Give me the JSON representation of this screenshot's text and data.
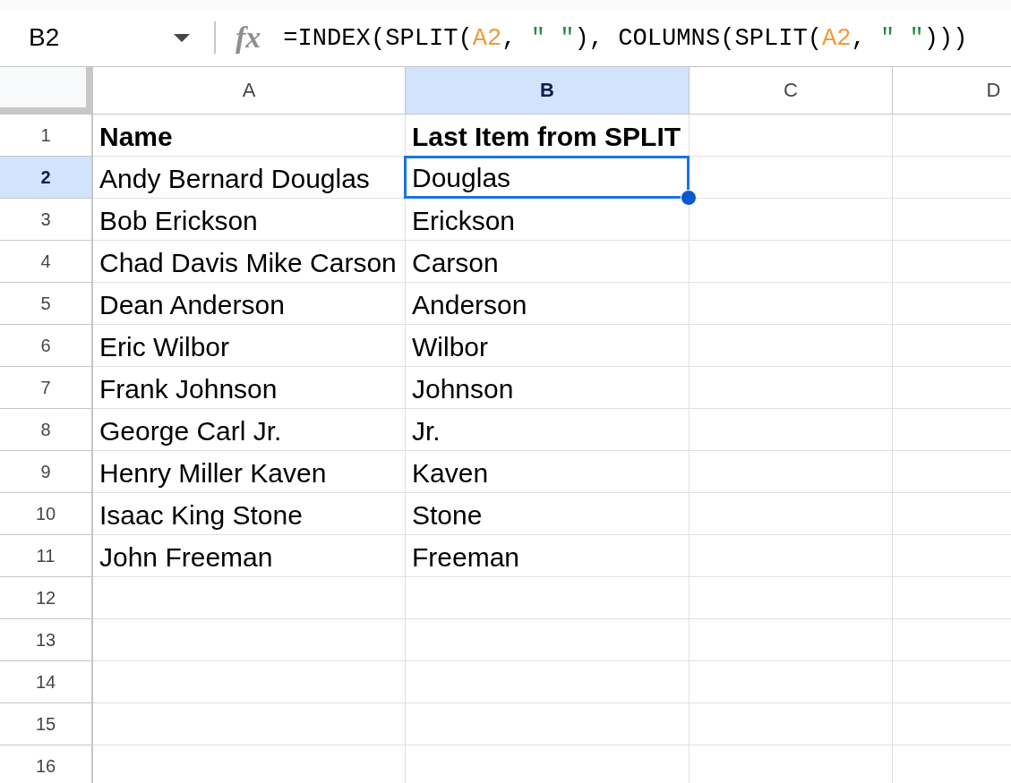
{
  "name_box": {
    "value": "B2"
  },
  "formula_bar": {
    "icon_text": "fx",
    "formula": [
      {
        "text": "=INDEX(SPLIT(",
        "kind": "plain"
      },
      {
        "text": "A2",
        "kind": "ref"
      },
      {
        "text": ", ",
        "kind": "plain"
      },
      {
        "text": "\" \"",
        "kind": "string"
      },
      {
        "text": "), COLUMNS(SPLIT(",
        "kind": "plain"
      },
      {
        "text": "A2",
        "kind": "ref"
      },
      {
        "text": ", ",
        "kind": "plain"
      },
      {
        "text": "\" \"",
        "kind": "string"
      },
      {
        "text": ")))",
        "kind": "plain"
      }
    ]
  },
  "columns": [
    {
      "label": "A",
      "selected": false
    },
    {
      "label": "B",
      "selected": true
    },
    {
      "label": "C",
      "selected": false
    },
    {
      "label": "D",
      "selected": false
    }
  ],
  "rows": [
    {
      "number": "1",
      "selected": false,
      "kind": "header",
      "cells": [
        {
          "text": "Name",
          "selected": false
        },
        {
          "text": "Last Item from SPLIT",
          "selected": false
        }
      ]
    },
    {
      "number": "2",
      "selected": true,
      "kind": "data",
      "cells": [
        {
          "text": "Andy Bernard Douglas",
          "selected": false
        },
        {
          "text": "Douglas",
          "selected": true
        }
      ]
    },
    {
      "number": "3",
      "selected": false,
      "kind": "data",
      "cells": [
        {
          "text": "Bob Erickson",
          "selected": false
        },
        {
          "text": "Erickson",
          "selected": false
        }
      ]
    },
    {
      "number": "4",
      "selected": false,
      "kind": "data",
      "cells": [
        {
          "text": "Chad Davis Mike Carson",
          "selected": false
        },
        {
          "text": "Carson",
          "selected": false
        }
      ]
    },
    {
      "number": "5",
      "selected": false,
      "kind": "data",
      "cells": [
        {
          "text": "Dean Anderson",
          "selected": false
        },
        {
          "text": "Anderson",
          "selected": false
        }
      ]
    },
    {
      "number": "6",
      "selected": false,
      "kind": "data",
      "cells": [
        {
          "text": "Eric Wilbor",
          "selected": false
        },
        {
          "text": "Wilbor",
          "selected": false
        }
      ]
    },
    {
      "number": "7",
      "selected": false,
      "kind": "data",
      "cells": [
        {
          "text": "Frank Johnson",
          "selected": false
        },
        {
          "text": "Johnson",
          "selected": false
        }
      ]
    },
    {
      "number": "8",
      "selected": false,
      "kind": "data",
      "cells": [
        {
          "text": "George Carl Jr.",
          "selected": false
        },
        {
          "text": "Jr.",
          "selected": false
        }
      ]
    },
    {
      "number": "9",
      "selected": false,
      "kind": "data",
      "cells": [
        {
          "text": "Henry Miller Kaven",
          "selected": false
        },
        {
          "text": "Kaven",
          "selected": false
        }
      ]
    },
    {
      "number": "10",
      "selected": false,
      "kind": "data",
      "cells": [
        {
          "text": "Isaac King Stone",
          "selected": false
        },
        {
          "text": "Stone",
          "selected": false
        }
      ]
    },
    {
      "number": "11",
      "selected": false,
      "kind": "data",
      "cells": [
        {
          "text": "John Freeman",
          "selected": false
        },
        {
          "text": "Freeman",
          "selected": false
        }
      ]
    },
    {
      "number": "12",
      "selected": false
    },
    {
      "number": "13",
      "selected": false
    },
    {
      "number": "14",
      "selected": false
    },
    {
      "number": "15",
      "selected": false
    },
    {
      "number": "16",
      "selected": false
    }
  ]
}
